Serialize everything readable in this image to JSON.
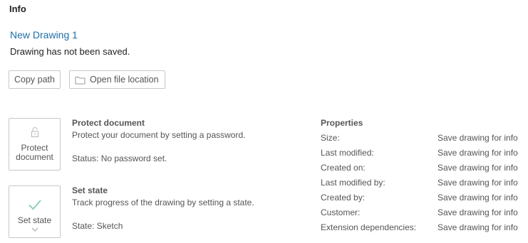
{
  "header": {
    "title": "Info"
  },
  "document": {
    "name": "New Drawing 1",
    "status_text": "Drawing has not been saved."
  },
  "actions": {
    "copy_path_label": "Copy path",
    "open_file_location_label": "Open file location"
  },
  "protect": {
    "tile_label_line1": "Protect",
    "tile_label_line2": "document",
    "title": "Protect document",
    "description": "Protect your document by setting a password.",
    "status": "Status: No password set.",
    "icon": "lock-icon"
  },
  "set_state": {
    "tile_label": "Set state",
    "title": "Set state",
    "description": "Track progress of the drawing by setting a state.",
    "state": "State: Sketch",
    "icon": "checkmark-icon",
    "accent_color": "#8fcfb8"
  },
  "properties": {
    "title": "Properties",
    "rows": [
      {
        "key": "Size:",
        "value": "Save drawing for info"
      },
      {
        "key": "Last modified:",
        "value": "Save drawing for info"
      },
      {
        "key": "Created on:",
        "value": "Save drawing for info"
      },
      {
        "key": "Last modified by:",
        "value": "Save drawing for info"
      },
      {
        "key": "Created by:",
        "value": "Save drawing for info"
      },
      {
        "key": "Customer:",
        "value": "Save drawing for info"
      },
      {
        "key": "Extension dependencies:",
        "value": "Save drawing for info"
      }
    ]
  },
  "colors": {
    "link": "#1f6fa8",
    "border": "#c8c8c8",
    "text_muted": "#555555"
  }
}
